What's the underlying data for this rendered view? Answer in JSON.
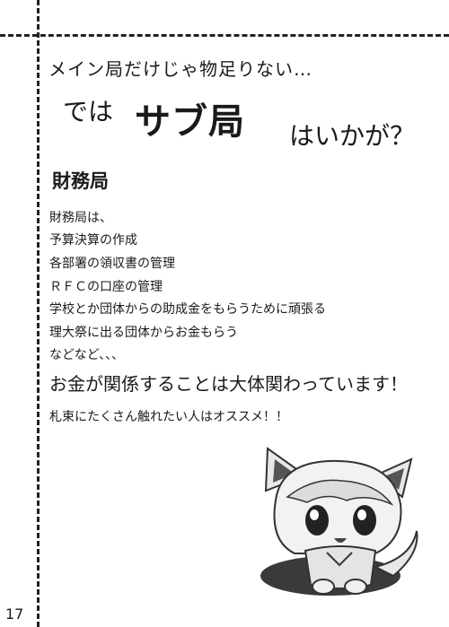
{
  "intro": {
    "line1": "メイン局だけじゃ物足りない…",
    "de_wa": "では",
    "sub_kyoku": "サブ局",
    "ikaga": "はいかが？"
  },
  "department": {
    "title": "財務局",
    "description_lines": [
      "財務局は、",
      "予算決算の作成",
      "各部署の領収書の管理",
      "ＲＦＣの口座の管理",
      "学校とか団体からの助成金をもらうために頑張る",
      "理大祭に出る団体からお金もらう",
      "などなど、、、"
    ],
    "highlight": "お金が関係することは大体関わっています！",
    "recommendation": "札束にたくさん触れたい人はオススメ！！"
  },
  "page_number": "17",
  "illustration": {
    "icon": "chibi-fox-girl-mascot"
  }
}
